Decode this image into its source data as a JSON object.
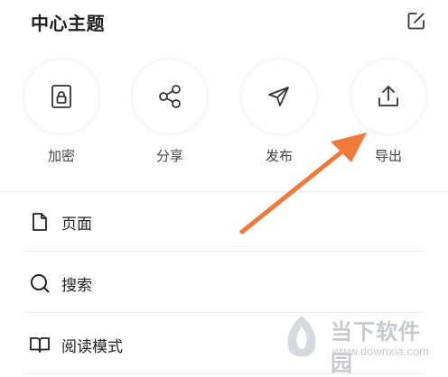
{
  "header": {
    "title": "中心主题",
    "edit_icon": "edit-icon"
  },
  "actions": [
    {
      "label": "加密",
      "icon": "lock-icon"
    },
    {
      "label": "分享",
      "icon": "share-icon"
    },
    {
      "label": "发布",
      "icon": "send-icon"
    },
    {
      "label": "导出",
      "icon": "export-icon"
    }
  ],
  "menu": [
    {
      "label": "页面",
      "icon": "page-icon"
    },
    {
      "label": "搜索",
      "icon": "search-icon"
    },
    {
      "label": "阅读模式",
      "icon": "book-icon"
    }
  ],
  "annotation": {
    "arrow_color": "#f07a3a",
    "target": "导出"
  },
  "watermark": {
    "name": "当下软件园",
    "url": "www.downxia.com"
  }
}
